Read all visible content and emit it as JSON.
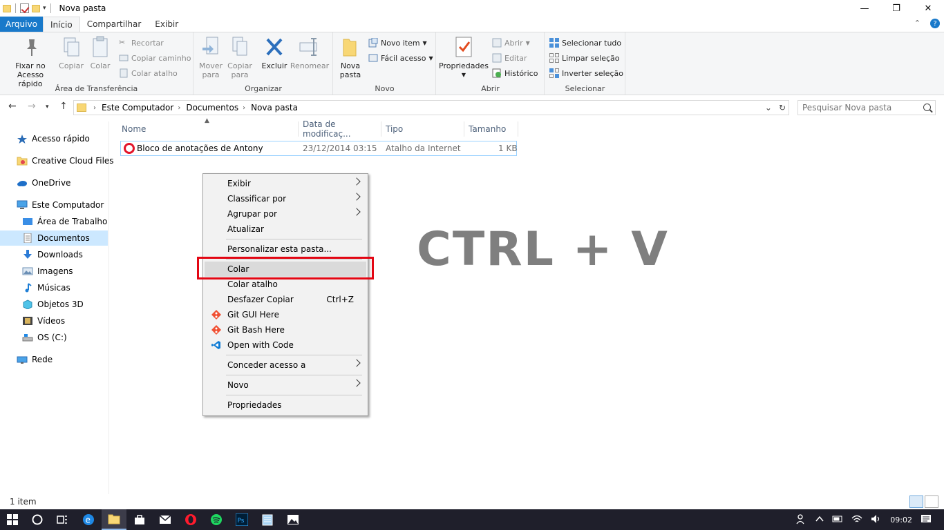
{
  "window": {
    "title": "Nova pasta"
  },
  "ribbon_tabs": [
    {
      "label": "Arquivo"
    },
    {
      "label": "Início"
    },
    {
      "label": "Compartilhar"
    },
    {
      "label": "Exibir"
    }
  ],
  "ribbon": {
    "clipboard": {
      "pin_label_1": "Fixar no",
      "pin_label_2": "Acesso rápido",
      "copy": "Copiar",
      "paste": "Colar",
      "cut": "Recortar",
      "copy_path": "Copiar caminho",
      "paste_shortcut": "Colar atalho",
      "group": "Área de Transferência"
    },
    "organize": {
      "move_1": "Mover",
      "move_2": "para",
      "copy_to_1": "Copiar",
      "copy_to_2": "para",
      "delete": "Excluir",
      "rename": "Renomear",
      "group": "Organizar"
    },
    "new": {
      "new_folder_1": "Nova",
      "new_folder_2": "pasta",
      "new_item": "Novo item",
      "easy_access": "Fácil acesso",
      "group": "Novo"
    },
    "open": {
      "properties": "Propriedades",
      "open": "Abrir",
      "edit": "Editar",
      "history": "Histórico",
      "group": "Abrir"
    },
    "select": {
      "select_all": "Selecionar tudo",
      "select_none": "Limpar seleção",
      "invert": "Inverter seleção",
      "group": "Selecionar"
    }
  },
  "address": {
    "crumbs": [
      "Este Computador",
      "Documentos",
      "Nova pasta"
    ],
    "search_placeholder": "Pesquisar Nova pasta"
  },
  "nav_pane": {
    "items": [
      {
        "label": "Acesso rápido",
        "icon": "star-icon"
      },
      {
        "label": "Creative Cloud Files",
        "icon": "cc-folder-icon"
      },
      {
        "label": "OneDrive",
        "icon": "cloud-icon"
      },
      {
        "label": "Este Computador",
        "icon": "computer-icon"
      },
      {
        "label": "Área de Trabalho",
        "icon": "desktop-icon"
      },
      {
        "label": "Documentos",
        "icon": "documents-icon"
      },
      {
        "label": "Downloads",
        "icon": "download-icon"
      },
      {
        "label": "Imagens",
        "icon": "pictures-icon"
      },
      {
        "label": "Músicas",
        "icon": "music-icon"
      },
      {
        "label": "Objetos 3D",
        "icon": "cube-icon"
      },
      {
        "label": "Vídeos",
        "icon": "film-icon"
      },
      {
        "label": "OS (C:)",
        "icon": "drive-icon"
      },
      {
        "label": "Rede",
        "icon": "network-icon"
      }
    ]
  },
  "file_list": {
    "columns": [
      "Nome",
      "Data de modificaç...",
      "Tipo",
      "Tamanho"
    ],
    "rows": [
      {
        "name": "Bloco de anotações de Antony",
        "date": "23/12/2014 03:15",
        "type": "Atalho da Internet",
        "size": "1 KB"
      }
    ]
  },
  "overlay": {
    "text": "CTRL + V"
  },
  "context_menu": {
    "items": [
      {
        "label": "Exibir"
      },
      {
        "label": "Classificar por"
      },
      {
        "label": "Agrupar por"
      },
      {
        "label": "Atualizar"
      },
      {
        "label": "Personalizar esta pasta..."
      },
      {
        "label": "Colar"
      },
      {
        "label": "Colar atalho"
      },
      {
        "label": "Desfazer Copiar",
        "shortcut": "Ctrl+Z"
      },
      {
        "label": "Git GUI Here"
      },
      {
        "label": "Git Bash Here"
      },
      {
        "label": "Open with Code"
      },
      {
        "label": "Conceder acesso a"
      },
      {
        "label": "Novo"
      },
      {
        "label": "Propriedades"
      }
    ]
  },
  "status": {
    "count": "1 item"
  },
  "taskbar": {
    "time": "09:02"
  },
  "colors": {
    "accent": "#1979ca",
    "highlight_box": "#e30613",
    "overlay_text": "#7f7f7f"
  }
}
